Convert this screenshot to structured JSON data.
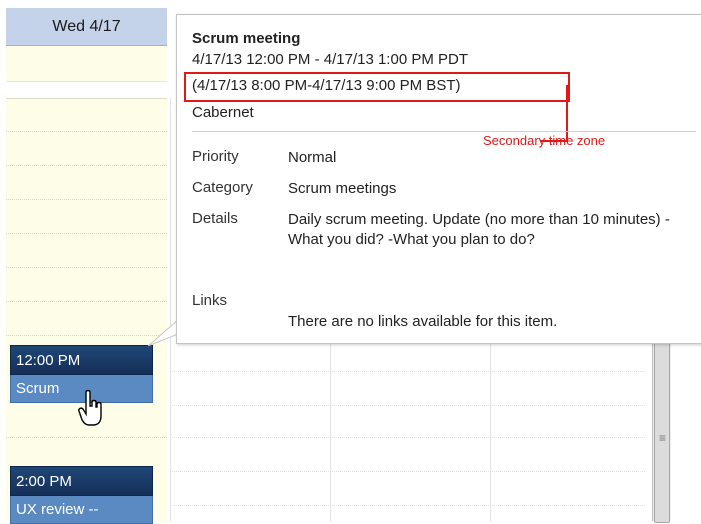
{
  "calendar": {
    "day_header": "Wed 4/17",
    "events": [
      {
        "time": "12:00 PM",
        "title": "Scrum"
      },
      {
        "time": "2:00 PM",
        "title": "UX review --"
      }
    ]
  },
  "popup": {
    "title": "Scrum meeting",
    "time_primary": "4/17/13 12:00 PM - 4/17/13 1:00 PM PDT",
    "time_secondary": "(4/17/13 8:00 PM-4/17/13 9:00 PM BST)",
    "location": "Cabernet",
    "priority_label": "Priority",
    "priority_value": "Normal",
    "category_label": "Category",
    "category_value": "Scrum meetings",
    "details_label": "Details",
    "details_value": "Daily scrum meeting. Update (no more than 10 minutes) -What you did? -What you plan to do?",
    "links_label": "Links",
    "links_value": "There are no links available for this item."
  },
  "annotation": {
    "callout_text": "Secondary time zone",
    "color": "#e01818"
  },
  "icons": [
    "hand-cursor-icon",
    "scrollbar-grip-icon"
  ]
}
